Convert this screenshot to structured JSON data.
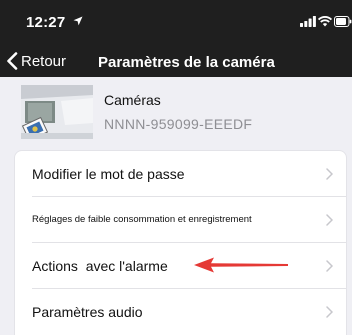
{
  "status_bar": {
    "time": "12:27",
    "icons": [
      "location-arrow-icon",
      "signal-bars-icon",
      "wifi-icon",
      "battery-icon"
    ]
  },
  "nav": {
    "back_label": "Retour",
    "title": "Paramètres de la caméra"
  },
  "camera": {
    "name": "Caméras",
    "id": "NNNN-959099-EEEDF"
  },
  "settings": {
    "items": [
      {
        "label": "Modifier le mot de passe"
      },
      {
        "label": "Réglages de faible consommation et enregistrement"
      },
      {
        "label": "Actions  avec l'alarme"
      },
      {
        "label": "Paramètres audio"
      }
    ]
  },
  "colors": {
    "nav_background": "#1f1f1f",
    "page_background": "#efeff4",
    "annotation_arrow": "#e53935",
    "chevron": "#c7c7cc"
  }
}
